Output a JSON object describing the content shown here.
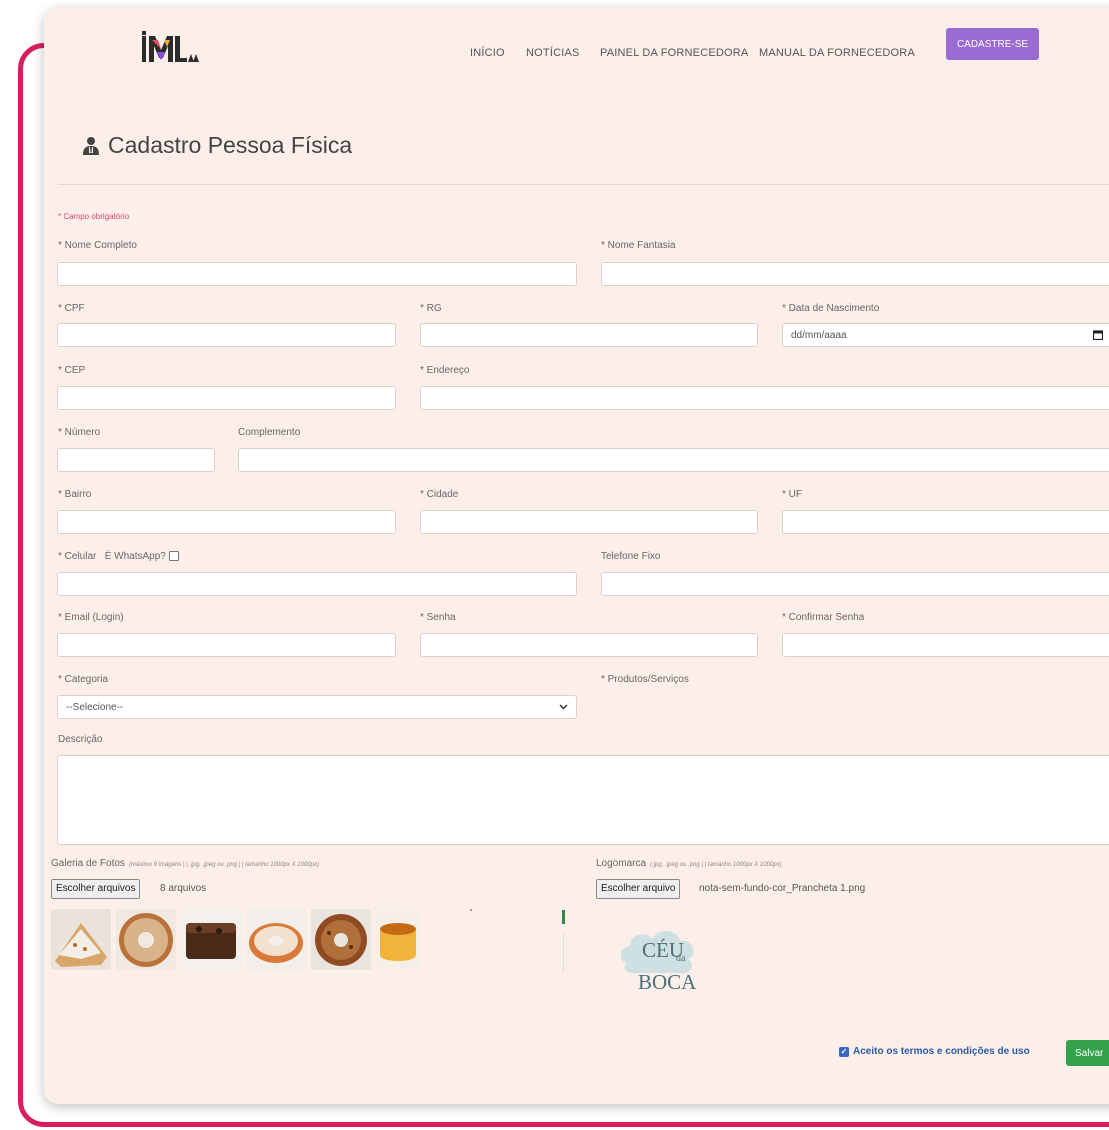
{
  "nav": {
    "inicio": "INÍCIO",
    "noticias": "NOTÍCIAS",
    "painel": "PAINEL DA FORNECEDORA",
    "manual": "MANUAL DA FORNECEDORA",
    "cadastre": "CADASTRE-SE"
  },
  "page": {
    "title": "Cadastro Pessoa Física",
    "required_note": "* Campo obrigatório"
  },
  "form": {
    "nome_completo": "* Nome Completo",
    "nome_fantasia": "* Nome Fantasia",
    "cpf": "* CPF",
    "rg": "* RG",
    "data_nascimento": "* Data de Nascimento",
    "data_placeholder": "dd/mm/aaaa",
    "cep": "* CEP",
    "endereco": "* Endereço",
    "numero": "* Número",
    "complemento": "Complemento",
    "bairro": "* Bairro",
    "cidade": "* Cidade",
    "uf": "* UF",
    "celular": "* Celular",
    "whatsapp": "É WhatsApp?",
    "telefone_fixo": "Telefone Fixo",
    "email": "* Email (Login)",
    "senha": "* Senha",
    "confirmar_senha": "* Confirmar Senha",
    "categoria": "* Categoria",
    "categoria_selected": "--Selecione--",
    "produtos": "* Produtos/Serviços",
    "descricao": "Descrição"
  },
  "uploads": {
    "galeria_label": "Galeria de Fotos",
    "galeria_hint": "(máximo 9 imagens | | .jpg, .jpeg ou .png | | tamanho 1000px X 1000px)",
    "galeria_button": "Escolher arquivos",
    "galeria_count": "8 arquivos",
    "logo_label": "Logomarca",
    "logo_hint": "(.jpg, .jpeg ou .png | | tamanho 1000px X 1000px)",
    "logo_button": "Escolher arquivo",
    "logo_file": "nota-sem-fundo-cor_Prancheta 1.png",
    "logo_text_line1": "CÉU",
    "logo_text_small": "da",
    "logo_text_line2": "BOCA"
  },
  "footer": {
    "terms": "Aceito os termos e condições de uso",
    "save": "Salvar"
  },
  "colors": {
    "frame": "#d81f5c",
    "card_bg": "#fcefea",
    "cadastre_btn": "#9b6bd4",
    "save_btn": "#33a24b",
    "terms_text": "#2a5aa8"
  }
}
